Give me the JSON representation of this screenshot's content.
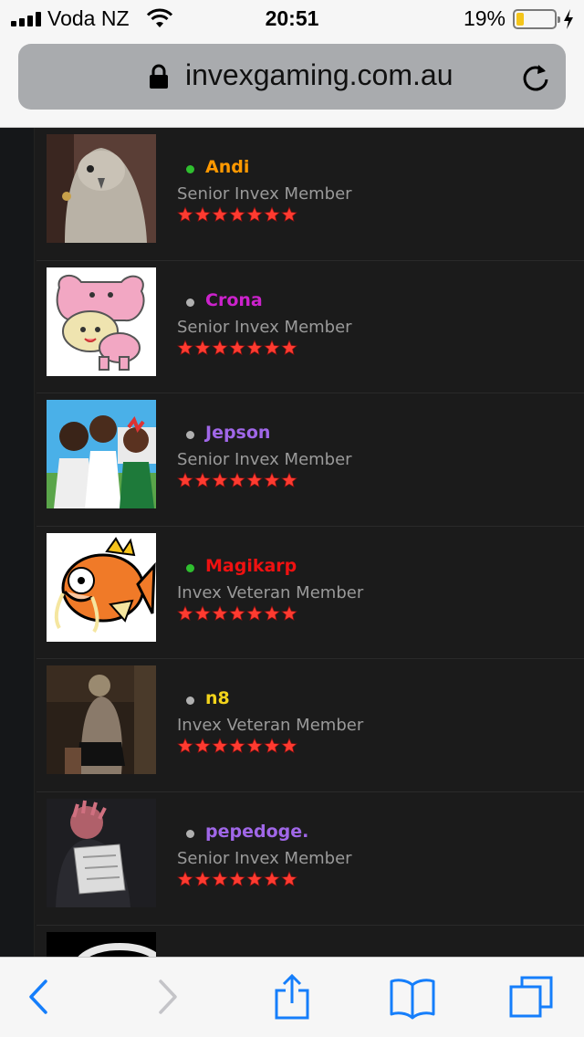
{
  "status_bar": {
    "carrier": "Voda NZ",
    "time": "20:51",
    "battery": "19%",
    "battery_level": 0.19
  },
  "browser": {
    "url": "invexgaming.com.au"
  },
  "icons": {
    "signal": "signal-bars-icon",
    "wifi": "wifi-icon",
    "battery": "battery-icon",
    "charging": "charging-bolt-icon",
    "lock": "lock-icon",
    "reload": "reload-icon",
    "back": "back-chevron-icon",
    "forward": "forward-chevron-icon",
    "share": "share-icon",
    "bookmarks": "bookmarks-icon",
    "tabs": "tabs-icon",
    "star": "rating-star-icon"
  },
  "colors": {
    "online": "#2fbf2f",
    "offline": "#b0b0b0",
    "star": "#ff3b30",
    "accent": "#157efb"
  },
  "members": [
    {
      "name": "Andi",
      "rank": "Senior Invex Member",
      "online": true,
      "name_color": "#ff9900",
      "avatar": "cockatiel-photo",
      "stars": 7
    },
    {
      "name": "Crona",
      "rank": "Senior Invex Member",
      "online": false,
      "name_color": "#cc22cc",
      "avatar": "pink-bunny-hood-sprite",
      "stars": 7
    },
    {
      "name": "Jepson",
      "rank": "Senior Invex Member",
      "online": false,
      "name_color": "#a067e8",
      "avatar": "cartoon-trio",
      "stars": 7
    },
    {
      "name": "Magikarp",
      "rank": "Invex Veteran Member",
      "online": true,
      "name_color": "#ee1111",
      "avatar": "magikarp-drawing",
      "stars": 7
    },
    {
      "name": "n8",
      "rank": "Invex Veteran Member",
      "online": false,
      "name_color": "#f2d31b",
      "avatar": "elevator-photo",
      "stars": 7
    },
    {
      "name": "pepedoge.",
      "rank": "Senior Invex Member",
      "online": false,
      "name_color": "#a067e8",
      "avatar": "dark-photo",
      "stars": 7
    }
  ]
}
